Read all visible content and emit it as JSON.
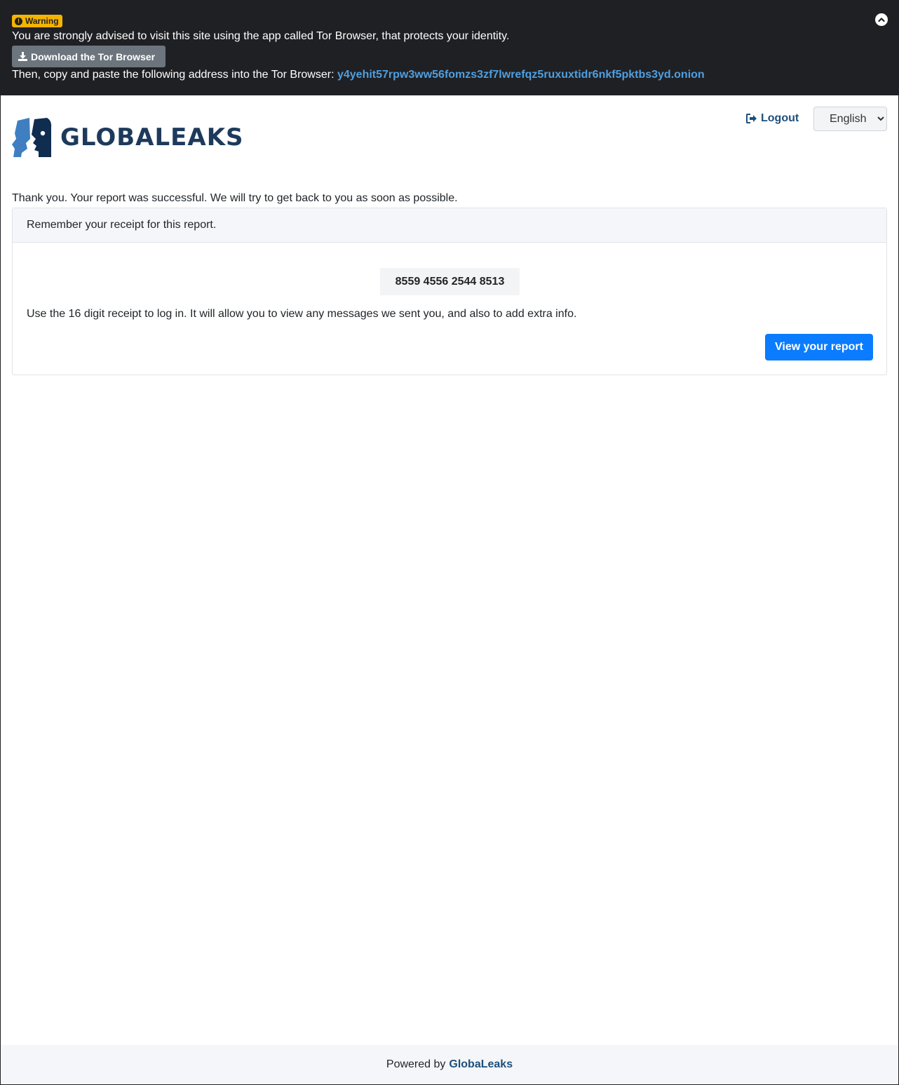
{
  "tor_banner": {
    "badge_label": "Warning",
    "advice": "You are strongly advised to visit this site using the app called Tor Browser, that protects your identity.",
    "download_label": "Download the Tor Browser",
    "copy_prefix": "Then, copy and paste the following address into the Tor Browser:",
    "onion_address": "y4yehit57rpw3ww56fomzs3zf7lwrefqz5ruxuxtidr6nkf5pktbs3yd.onion"
  },
  "header": {
    "logo_text": "GLOBALEAKS",
    "logout_label": "Logout",
    "language_selected": "English"
  },
  "main": {
    "thank_you": "Thank you. Your report was successful. We will try to get back to you as soon as possible.",
    "card_header": "Remember your receipt for this report.",
    "receipt_code": "8559 4556 2544 8513",
    "receipt_help": "Use the 16 digit receipt to log in. It will allow you to view any messages we sent you, and also to add extra info.",
    "view_button": "View your report"
  },
  "footer": {
    "powered_by": "Powered by",
    "brand": "GlobaLeaks"
  },
  "colors": {
    "banner_bg": "#1f2024",
    "warning_badge": "#f5b400",
    "onion_link": "#4f9fe0",
    "primary_button": "#0b7cff",
    "brand_blue": "#1d4f7c"
  }
}
